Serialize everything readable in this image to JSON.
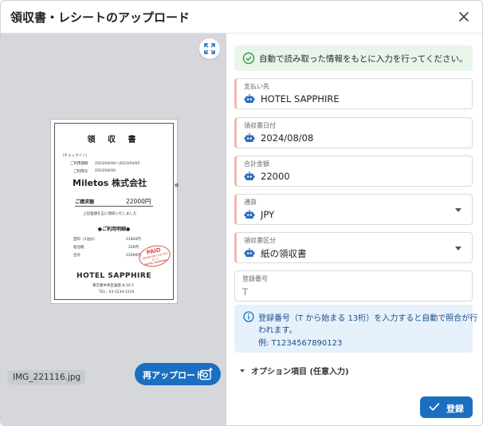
{
  "dialog": {
    "title": "領収書・レシートのアップロード"
  },
  "preview": {
    "filename": "IMG_221116.jpg",
    "reupload_label": "再アップロード",
    "receipt": {
      "heading": "領 収 書",
      "checkin_label": "［チェックイン］",
      "period_label": "ご利用期間",
      "period_value": "2023/04/04～2023/04/05",
      "date_label": "ご利用日",
      "date_value": "2023/04/04",
      "company": "Miletos 株式会社",
      "honorific": "様",
      "billing_label": "ご請求額",
      "billing_amount": "22000円",
      "received_note": "上記金額を正に領収いたしました",
      "details_heading": "●ご利用明細●",
      "lines": [
        {
          "label": "室料（2泊分）",
          "value": "21800円"
        },
        {
          "label": "宿泊税",
          "value": "200円"
        },
        {
          "label": "合計",
          "value": "22000円"
        }
      ],
      "stamp_text": "PAID",
      "stamp_sub": "ご請求額を確かに受け取りました",
      "stamp_hotel": "HOTEL SAPPHIRE",
      "hotel_name": "HOTEL SAPPHIRE",
      "address": "東京都中央区銀座 8-10-1",
      "tel": "TEL：03-1234-1234"
    }
  },
  "form": {
    "auto_fill_notice": "自動で読み取った情報をもとに入力を行ってください。",
    "fields": [
      {
        "label": "支払い先",
        "value": "HOTEL SAPPHIRE"
      },
      {
        "label": "領収書日付",
        "value": "2024/08/08"
      },
      {
        "label": "合計金額",
        "value": "22000"
      },
      {
        "label": "通貨",
        "value": "JPY"
      },
      {
        "label": "領収書区分",
        "value": "紙の領収書"
      }
    ],
    "registration": {
      "label": "登録番号",
      "placeholder": "T"
    },
    "info": {
      "line1": "登録番号（T から始まる 13桁）を入力すると自動で照合が行",
      "line2": "われます。",
      "line3": "例: T1234567890123"
    },
    "options_label": "オプション項目 (任意入力)",
    "submit_label": "登録"
  },
  "colors": {
    "primary": "#1a6fc0",
    "success_bg": "#e7f5ea",
    "info_bg": "#e6f1fb",
    "ai_marker": "#f3b7ad"
  }
}
